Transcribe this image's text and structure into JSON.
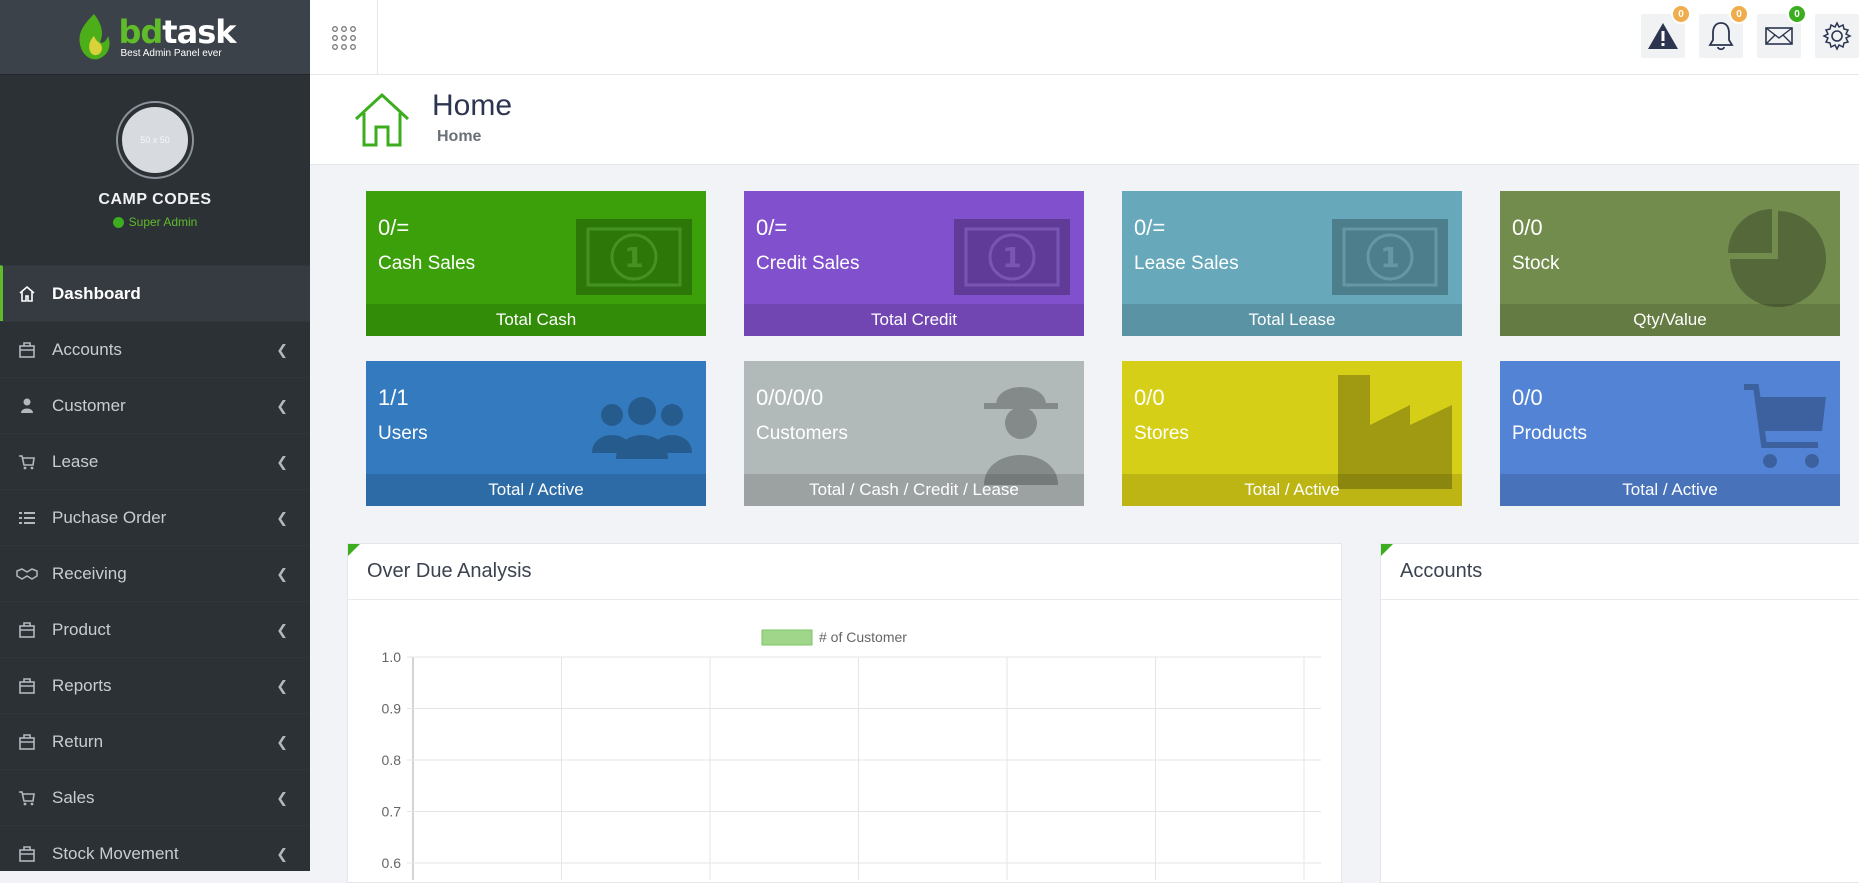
{
  "brand": {
    "word_part1": "bd",
    "word_part2": "task",
    "tagline": "Best Admin Panel ever"
  },
  "profile": {
    "avatar_text": "50 x 50",
    "name": "CAMP CODES",
    "role": "Super Admin"
  },
  "sidebar": {
    "items": [
      {
        "label": "Dashboard",
        "icon": "home-icon",
        "active": true
      },
      {
        "label": "Accounts",
        "icon": "briefcase-icon"
      },
      {
        "label": "Customer",
        "icon": "user-icon"
      },
      {
        "label": "Lease",
        "icon": "cart-icon"
      },
      {
        "label": "Puchase Order",
        "icon": "list-icon"
      },
      {
        "label": "Receiving",
        "icon": "handshake-icon"
      },
      {
        "label": "Product",
        "icon": "briefcase-icon"
      },
      {
        "label": "Reports",
        "icon": "briefcase-icon"
      },
      {
        "label": "Return",
        "icon": "briefcase-icon"
      },
      {
        "label": "Sales",
        "icon": "cart-icon"
      },
      {
        "label": "Stock Movement",
        "icon": "briefcase-icon"
      }
    ]
  },
  "topbar": {
    "alerts_count": "0",
    "notifications_count": "0",
    "messages_count": "0"
  },
  "page": {
    "title": "Home",
    "breadcrumb": "Home"
  },
  "cards": [
    {
      "value": "0/=",
      "label": "Cash Sales",
      "footer": "Total Cash",
      "color": "#3ba00a",
      "icon": "money-icon"
    },
    {
      "value": "0/=",
      "label": "Credit Sales",
      "footer": "Total Credit",
      "color": "#8150cc",
      "icon": "money-icon"
    },
    {
      "value": "0/=",
      "label": "Lease Sales",
      "footer": "Total Lease",
      "color": "#67a9bb",
      "icon": "money-icon"
    },
    {
      "value": "0/0",
      "label": "Stock",
      "footer": "Qty/Value",
      "color": "#728c4d",
      "icon": "pie-chart-icon"
    },
    {
      "value": "1/1",
      "label": "Users",
      "footer": "Total / Active",
      "color": "#347abe",
      "icon": "users-icon"
    },
    {
      "value": "0/0/0/0",
      "label": "Customers",
      "footer": "Total / Cash / Credit / Lease",
      "color": "#b2b9b9",
      "icon": "spy-icon"
    },
    {
      "value": "0/0",
      "label": "Stores",
      "footer": "Total / Active",
      "color": "#d6cf17",
      "icon": "factory-icon"
    },
    {
      "value": "0/0",
      "label": "Products",
      "footer": "Total / Active",
      "color": "#5383d5",
      "icon": "cart-icon"
    }
  ],
  "panels": {
    "overdue_title": "Over Due Analysis",
    "accounts_title": "Accounts"
  },
  "chart_data": {
    "type": "bar",
    "series": [
      {
        "name": "# of Customer",
        "values": []
      }
    ],
    "categories": [],
    "yticks": [
      "1.0",
      "0.9",
      "0.8",
      "0.7",
      "0.6"
    ],
    "ylim": [
      0,
      1.0
    ],
    "grid": true,
    "legend": "top-center",
    "series_color": "#9fd68a"
  }
}
